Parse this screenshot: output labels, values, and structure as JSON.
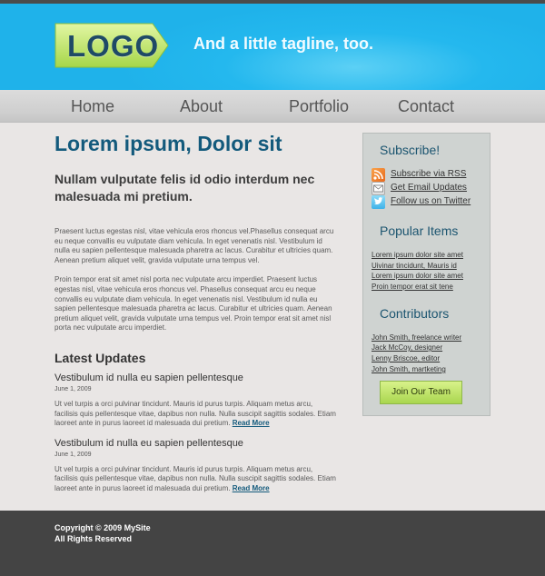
{
  "header": {
    "logo_text": "LOGO",
    "tagline": "And a little tagline, too."
  },
  "nav": {
    "items": [
      {
        "label": "Home"
      },
      {
        "label": "About"
      },
      {
        "label": "Portfolio"
      },
      {
        "label": "Contact"
      }
    ]
  },
  "main": {
    "title": "Lorem ipsum, Dolor sit",
    "subtitle": "Nullam vulputate felis id odio interdum nec malesuada mi pretium.",
    "paragraph1": "Praesent luctus egestas nisl, vitae vehicula eros rhoncus vel.Phasellus consequat arcu eu neque convallis eu vulputate diam vehicula. In eget venenatis nisl. Vestibulum id nulla eu sapien pellentesque malesuada pharetra ac lacus. Curabitur et ultricies quam. Aenean pretium aliquet velit, gravida vulputate urna tempus vel.",
    "paragraph2": "Proin tempor erat sit amet nisl porta nec vulputate arcu imperdiet. Praesent luctus egestas nisl, vitae vehicula eros rhoncus vel. Phasellus consequat arcu eu neque convallis eu vulputate diam vehicula. In eget venenatis nisl. Vestibulum id nulla eu sapien pellentesque malesuada pharetra ac lacus. Curabitur et ultricies quam. Aenean pretium aliquet velit, gravida vulputate urna tempus vel. Proin tempor erat sit amet nisl porta nec vulputate arcu imperdiet.",
    "updates_heading": "Latest Updates",
    "updates": [
      {
        "title": "Vestibulum id nulla eu sapien pellentesque",
        "date": "June 1, 2009",
        "body": "Ut vel turpis a orci pulvinar tincidunt. Mauris id purus turpis. Aliquam metus arcu, facilisis quis pellentesque vitae, dapibus non nulla. Nulla suscipit sagittis sodales. Etiam laoreet ante in purus laoreet id malesuada dui pretium.",
        "read_more": "Read More"
      },
      {
        "title": "Vestibulum id nulla eu sapien pellentesque",
        "date": "June 1, 2009",
        "body": "Ut vel turpis a orci pulvinar tincidunt. Mauris id purus turpis. Aliquam metus arcu, facilisis quis pellentesque vitae, dapibus non nulla. Nulla suscipit sagittis sodales. Etiam laoreet ante in purus laoreet id malesuada dui pretium.",
        "read_more": "Read More"
      }
    ]
  },
  "sidebar": {
    "subscribe_heading": "Subscribe!",
    "subscribe_links": [
      {
        "label": "Subscribe via RSS",
        "icon": "rss-icon"
      },
      {
        "label": "Get Email Updates",
        "icon": "email-icon"
      },
      {
        "label": "Follow us on Twitter",
        "icon": "twitter-icon"
      }
    ],
    "popular_heading": "Popular Items",
    "popular_items": [
      "Lorem ipsum dolor site amet",
      "Uivinar tincidunt, Mauris id",
      "Lorem ipsum dolor site amet",
      "Proin tempor erat sit tene"
    ],
    "contributors_heading": "Contributors",
    "contributors": [
      "John Smith, freelance writer",
      "Jack McCoy, designer",
      "Lenny Briscoe, editor",
      "John Smith, martketing"
    ],
    "join_label": "Join Our Team"
  },
  "footer": {
    "copyright": "Copyright © 2009 MySite",
    "rights": "All Rights Reserved"
  },
  "colors": {
    "header_blue": "#1fb2ea",
    "title_blue": "#135a7c",
    "footer_bg": "#444444",
    "logo_green": "#b6e05a"
  }
}
